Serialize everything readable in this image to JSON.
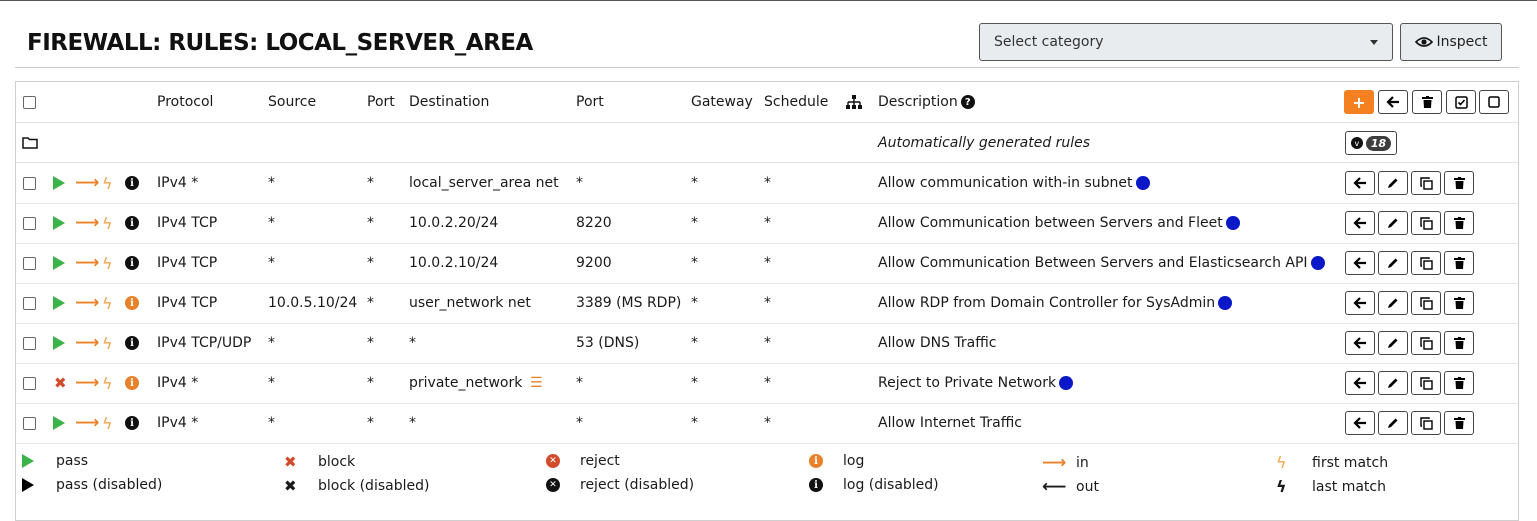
{
  "page_title": "FIREWALL: RULES: LOCAL_SERVER_AREA",
  "category_select": {
    "value": "Select category"
  },
  "inspect_label": "Inspect",
  "headers": {
    "protocol": "Protocol",
    "source": "Source",
    "port": "Port",
    "destination": "Destination",
    "dest_port": "Port",
    "gateway": "Gateway",
    "schedule": "Schedule",
    "description": "Description"
  },
  "auto_rules": {
    "label": "Automatically generated rules",
    "count": "18"
  },
  "rules": [
    {
      "action": "pass",
      "log": false,
      "protocol": "IPv4 *",
      "source": "*",
      "port": "*",
      "destination": "local_server_area net",
      "dest_port": "*",
      "gateway": "*",
      "schedule": "*",
      "description": "Allow communication with-in subnet",
      "dot": true,
      "alias": false
    },
    {
      "action": "pass",
      "log": false,
      "protocol": "IPv4 TCP",
      "source": "*",
      "port": "*",
      "destination": "10.0.2.20/24",
      "dest_port": "8220",
      "gateway": "*",
      "schedule": "*",
      "description": "Allow Communication between Servers and Fleet",
      "dot": true,
      "alias": false
    },
    {
      "action": "pass",
      "log": false,
      "protocol": "IPv4 TCP",
      "source": "*",
      "port": "*",
      "destination": "10.0.2.10/24",
      "dest_port": "9200",
      "gateway": "*",
      "schedule": "*",
      "description": "Allow Communication Between Servers and Elasticsearch API",
      "dot": true,
      "alias": false
    },
    {
      "action": "pass",
      "log": true,
      "protocol": "IPv4 TCP",
      "source": "10.0.5.10/24",
      "port": "*",
      "destination": "user_network net",
      "dest_port": "3389 (MS RDP)",
      "gateway": "*",
      "schedule": "*",
      "description": "Allow RDP from Domain Controller for SysAdmin",
      "dot": true,
      "alias": false
    },
    {
      "action": "pass",
      "log": false,
      "protocol": "IPv4 TCP/UDP",
      "source": "*",
      "port": "*",
      "destination": "*",
      "dest_port": "53 (DNS)",
      "gateway": "*",
      "schedule": "*",
      "description": "Allow DNS Traffic",
      "dot": false,
      "alias": false
    },
    {
      "action": "block",
      "log": true,
      "protocol": "IPv4 *",
      "source": "*",
      "port": "*",
      "destination": "private_network",
      "dest_port": "*",
      "gateway": "*",
      "schedule": "*",
      "description": "Reject to Private Network",
      "dot": true,
      "alias": true
    },
    {
      "action": "pass",
      "log": false,
      "protocol": "IPv4 *",
      "source": "*",
      "port": "*",
      "destination": "*",
      "dest_port": "*",
      "gateway": "*",
      "schedule": "*",
      "description": "Allow Internet Traffic",
      "dot": false,
      "alias": false
    }
  ],
  "legend": {
    "pass": "pass",
    "pass_disabled": "pass (disabled)",
    "block": "block",
    "block_disabled": "block (disabled)",
    "reject": "reject",
    "reject_disabled": "reject (disabled)",
    "log": "log",
    "log_disabled": "log (disabled)",
    "in": "in",
    "out": "out",
    "first_match": "first match",
    "last_match": "last match"
  },
  "colors": {
    "pass": "#3cb34a",
    "block": "#d24b2b",
    "accent": "#f4801f",
    "dot": "#0a18c8"
  }
}
